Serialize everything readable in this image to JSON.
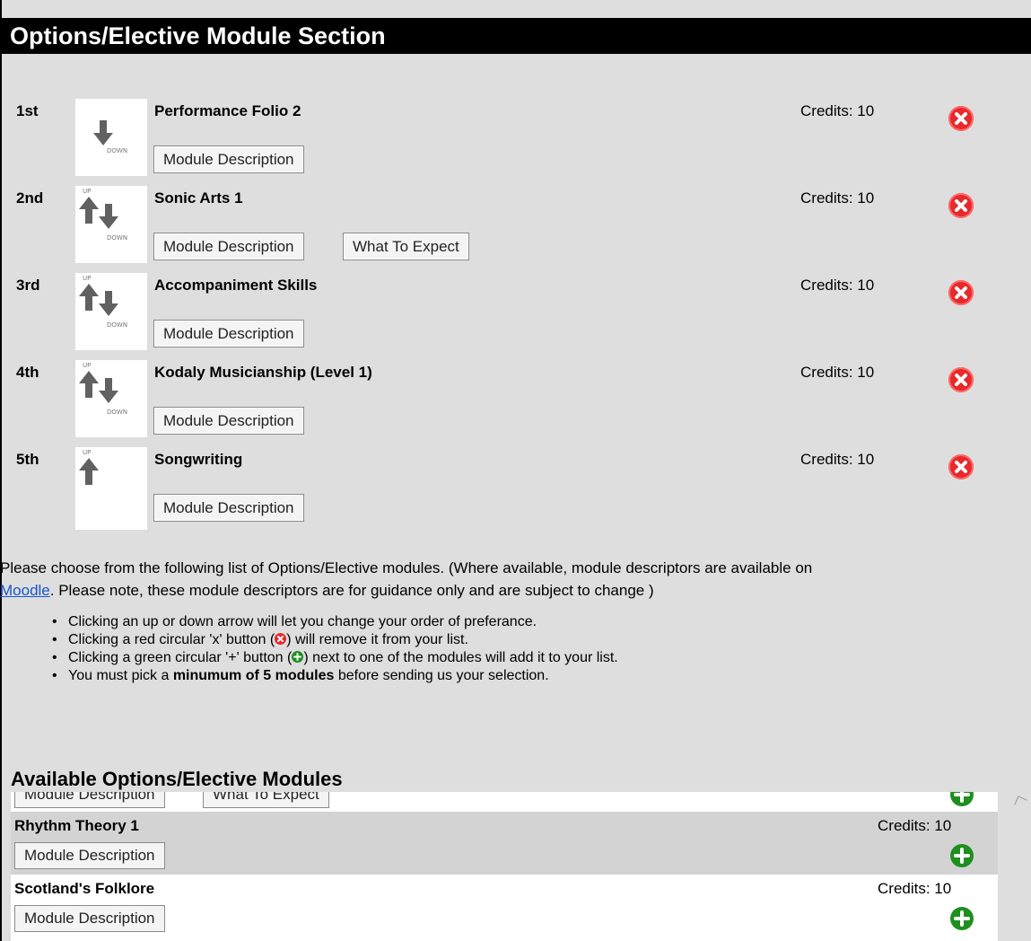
{
  "section_title": "Options/Elective Module Section",
  "chosen_modules": [
    {
      "rank": "1st",
      "title": "Performance Folio 2",
      "credits": "Credits: 10",
      "buttons": [
        "Module Description"
      ],
      "arrows": {
        "up": false,
        "down": true
      }
    },
    {
      "rank": "2nd",
      "title": "Sonic Arts 1",
      "credits": "Credits: 10",
      "buttons": [
        "Module Description",
        "What To Expect"
      ],
      "arrows": {
        "up": true,
        "down": true
      }
    },
    {
      "rank": "3rd",
      "title": "Accompaniment Skills",
      "credits": "Credits: 10",
      "buttons": [
        "Module Description"
      ],
      "arrows": {
        "up": true,
        "down": true
      }
    },
    {
      "rank": "4th",
      "title": "Kodaly Musicianship (Level 1)",
      "credits": "Credits: 10",
      "buttons": [
        "Module Description"
      ],
      "arrows": {
        "up": true,
        "down": true
      }
    },
    {
      "rank": "5th",
      "title": "Songwriting",
      "credits": "Credits: 10",
      "buttons": [
        "Module Description"
      ],
      "arrows": {
        "up": true,
        "down": false
      }
    }
  ],
  "arrow_labels": {
    "up": "UP",
    "down": "DOWN"
  },
  "instructions": {
    "intro_before_link": "Please choose from the following list of Options/Elective modules. (Where available, module descriptors are available on",
    "link_text": "Moodle",
    "intro_after_link": ". Please note, these module descriptors are for guidance only and are subject to change )",
    "bullet_1": "Clicking an up or down arrow will let you change your order of preferance.",
    "bullet_2_pre": "Clicking a red circular 'x' button (",
    "bullet_2_post": ") will remove it from your list.",
    "bullet_3_pre": "Clicking a green circular '+' button (",
    "bullet_3_post": ") next to one of the modules will add it to your list.",
    "bullet_4_pre": "You must pick a ",
    "bullet_4_bold": "minumum of 5 modules",
    "bullet_4_post": " before sending us your selection."
  },
  "available": {
    "title": "Available Options/Elective Modules",
    "partial_row_buttons": [
      "Module Description",
      "What To Expect"
    ],
    "rows": [
      {
        "title": "Rhythm Theory 1",
        "credits": "Credits: 10",
        "button": "Module Description",
        "highlighted": true
      },
      {
        "title": "Scotland's Folklore",
        "credits": "Credits: 10",
        "button": "Module Description",
        "highlighted": false
      }
    ]
  },
  "colors": {
    "remove": "#e8282b",
    "add": "#1f8f1f",
    "header_bg": "#000000",
    "page_bg": "#dedede",
    "link": "#1a55c8"
  }
}
